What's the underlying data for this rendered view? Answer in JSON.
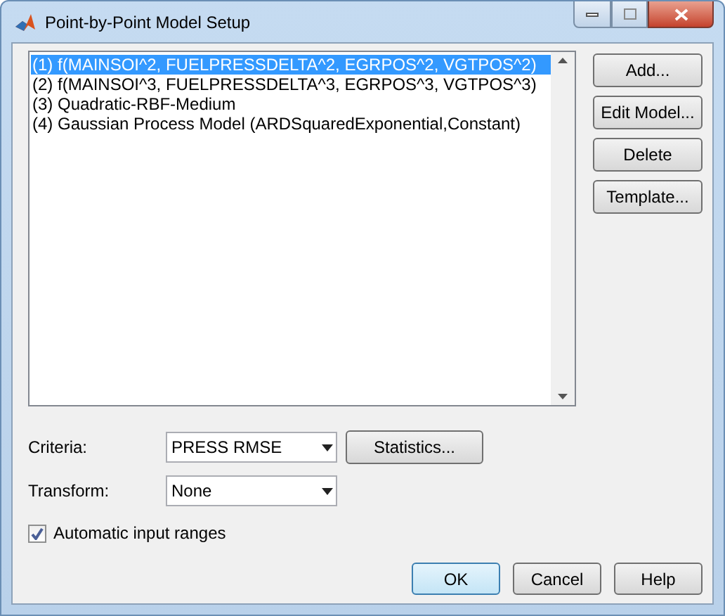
{
  "window": {
    "title": "Point-by-Point Model Setup"
  },
  "models": [
    {
      "label": "(1)  f(MAINSOI^2, FUELPRESSDELTA^2, EGRPOS^2, VGTPOS^2)",
      "selected": true
    },
    {
      "label": "(2)  f(MAINSOI^3, FUELPRESSDELTA^3, EGRPOS^3, VGTPOS^3)",
      "selected": false
    },
    {
      "label": "(3)  Quadratic-RBF-Medium",
      "selected": false
    },
    {
      "label": "(4)  Gaussian Process Model (ARDSquaredExponential,Constant)",
      "selected": false
    }
  ],
  "side_buttons": [
    "Add...",
    "Edit Model...",
    "Delete",
    "Template..."
  ],
  "criteria": {
    "label": "Criteria:",
    "value": "PRESS RMSE",
    "button": "Statistics..."
  },
  "transform": {
    "label": "Transform:",
    "value": "None"
  },
  "automatic_input_ranges": {
    "label": "Automatic input ranges",
    "checked": true
  },
  "buttons": [
    {
      "label": "OK",
      "default": true
    },
    {
      "label": "Cancel",
      "default": false
    },
    {
      "label": "Help",
      "default": false
    }
  ]
}
